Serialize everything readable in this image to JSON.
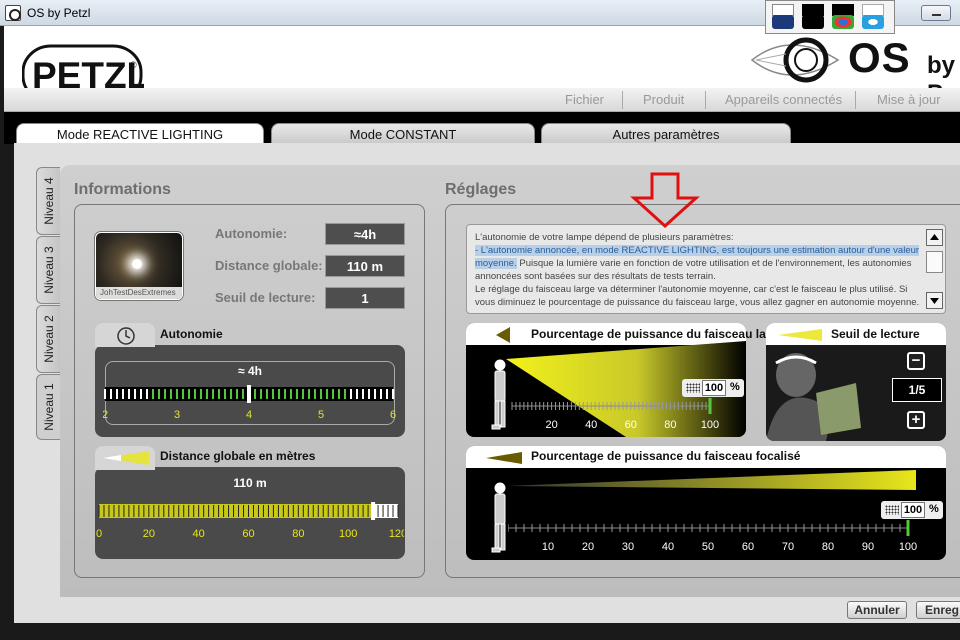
{
  "window": {
    "title": "OS by Petzl"
  },
  "brand": {
    "logo": "PETZL",
    "registered": "®",
    "product": "OS",
    "product_suffix": "by P"
  },
  "menu": [
    "Fichier",
    "Produit",
    "Appareils connectés",
    "Mise à jour"
  ],
  "tabs": [
    "Mode REACTIVE LIGHTING",
    "Mode CONSTANT",
    "Autres paramètres"
  ],
  "levels": [
    "Niveau 4",
    "Niveau 3",
    "Niveau 2",
    "Niveau 1"
  ],
  "informations": {
    "title": "Informations",
    "photo_caption": "JohTestDesExtremes",
    "rows": [
      {
        "label": "Autonomie:",
        "value": "≈4h"
      },
      {
        "label": "Distance globale:",
        "value": "110 m"
      },
      {
        "label": "Seuil de lecture:",
        "value": "1"
      }
    ]
  },
  "autonomy": {
    "title": "Autonomie",
    "value": "≈ 4h",
    "scale": [
      "2",
      "3",
      "4",
      "5",
      "6"
    ],
    "range": [
      2,
      6
    ],
    "marker": 4
  },
  "distance": {
    "title": "Distance globale en mètres",
    "value": "110 m",
    "scale": [
      "0",
      "20",
      "40",
      "60",
      "80",
      "100",
      "120"
    ],
    "range": [
      0,
      120
    ],
    "marker": 110
  },
  "reglages": {
    "title": "Réglages",
    "text_1": "L'autonomie de votre lampe dépend de plusieurs paramètres:",
    "text_highlight": "- L'autonomie annoncée, en mode REACTIVE LIGHTING, est toujours une estimation autour d'une valeur moyenne.",
    "text_2": " Puisque la lumière varie en fonction de votre utilisation et de l'environnement, les autonomies annoncées sont basées sur des résultats de tests terrain.",
    "text_3": "Le réglage du faisceau large va déterminer l'autonomie moyenne, car c'est le faisceau le plus utilisé. Si vous diminuez le pourcentage de puissance du faisceau large, vous allez gagner en autonomie moyenne."
  },
  "wide_beam": {
    "title": "Pourcentage de puissance du faisceau large",
    "value": "100",
    "unit": "%",
    "scale": [
      "20",
      "40",
      "60",
      "80",
      "100"
    ],
    "level": 100
  },
  "reading": {
    "title": "Seuil de lecture",
    "minus": "−",
    "plus": "+",
    "value": "1/5"
  },
  "focus_beam": {
    "title": "Pourcentage de puissance du faisceau focalisé",
    "value": "100",
    "unit": "%",
    "scale": [
      "10",
      "20",
      "30",
      "40",
      "50",
      "60",
      "70",
      "80",
      "90",
      "100"
    ],
    "level": 100
  },
  "buttons": {
    "cancel": "Annuler",
    "save": "Enreg"
  },
  "colors": {
    "accent_yellow": "#e8e61a",
    "green": "#55c83a",
    "dark_panel": "#4a4a4a",
    "arrow_red": "#e01010"
  }
}
